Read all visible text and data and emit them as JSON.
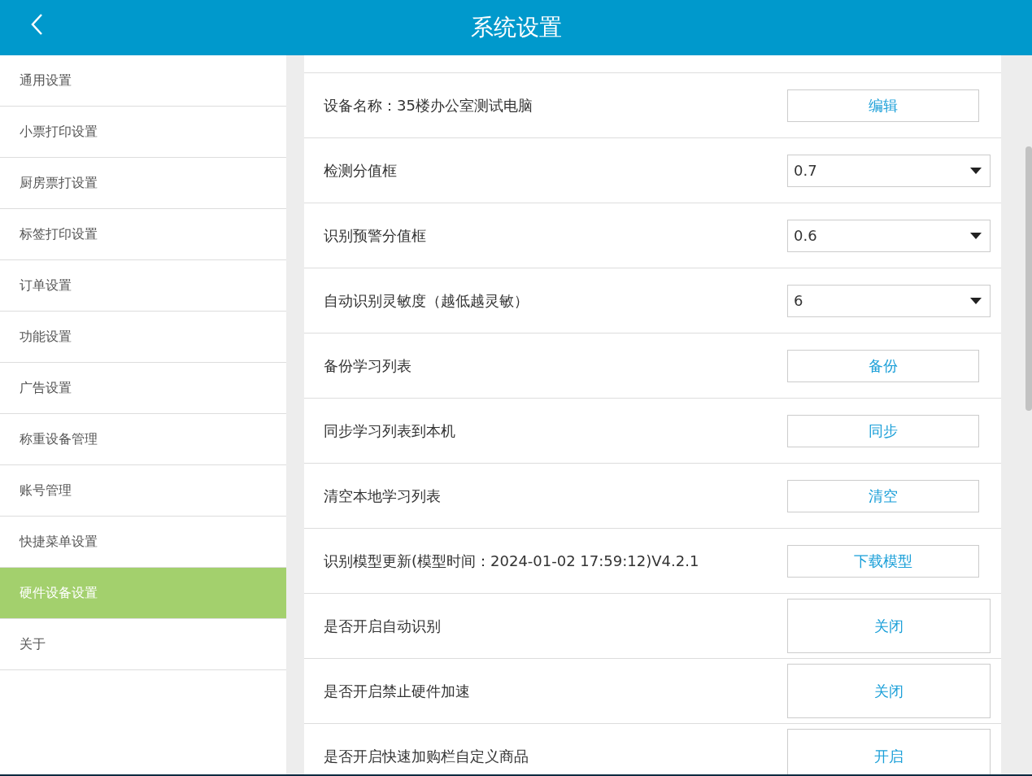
{
  "header": {
    "title": "系统设置"
  },
  "sidebar": {
    "items": [
      {
        "label": "通用设置",
        "selected": false
      },
      {
        "label": "小票打印设置",
        "selected": false
      },
      {
        "label": "厨房票打设置",
        "selected": false
      },
      {
        "label": "标签打印设置",
        "selected": false
      },
      {
        "label": "订单设置",
        "selected": false
      },
      {
        "label": "功能设置",
        "selected": false
      },
      {
        "label": "广告设置",
        "selected": false
      },
      {
        "label": "称重设备管理",
        "selected": false
      },
      {
        "label": "账号管理",
        "selected": false
      },
      {
        "label": "快捷菜单设置",
        "selected": false
      },
      {
        "label": "硬件设备设置",
        "selected": true
      },
      {
        "label": "关于",
        "selected": false
      }
    ]
  },
  "settings": [
    {
      "kind": "button",
      "label": "设备名称：35楼办公室测试电脑",
      "value": "编辑"
    },
    {
      "kind": "select",
      "label": "检测分值框",
      "value": "0.7"
    },
    {
      "kind": "select",
      "label": "识别预警分值框",
      "value": "0.6"
    },
    {
      "kind": "select",
      "label": "自动识别灵敏度（越低越灵敏）",
      "value": "6"
    },
    {
      "kind": "button",
      "label": "备份学习列表",
      "value": "备份"
    },
    {
      "kind": "button",
      "label": "同步学习列表到本机",
      "value": "同步"
    },
    {
      "kind": "button",
      "label": "清空本地学习列表",
      "value": "清空"
    },
    {
      "kind": "button",
      "label": "识别模型更新(模型时间：2024-01-02 17:59:12)V4.2.1",
      "value": "下载模型"
    },
    {
      "kind": "toggle",
      "label": "是否开启自动识别",
      "value": "关闭"
    },
    {
      "kind": "toggle",
      "label": "是否开启禁止硬件加速",
      "value": "关闭"
    },
    {
      "kind": "toggle",
      "label": "是否开启快速加购栏自定义商品",
      "value": "开启"
    }
  ]
}
